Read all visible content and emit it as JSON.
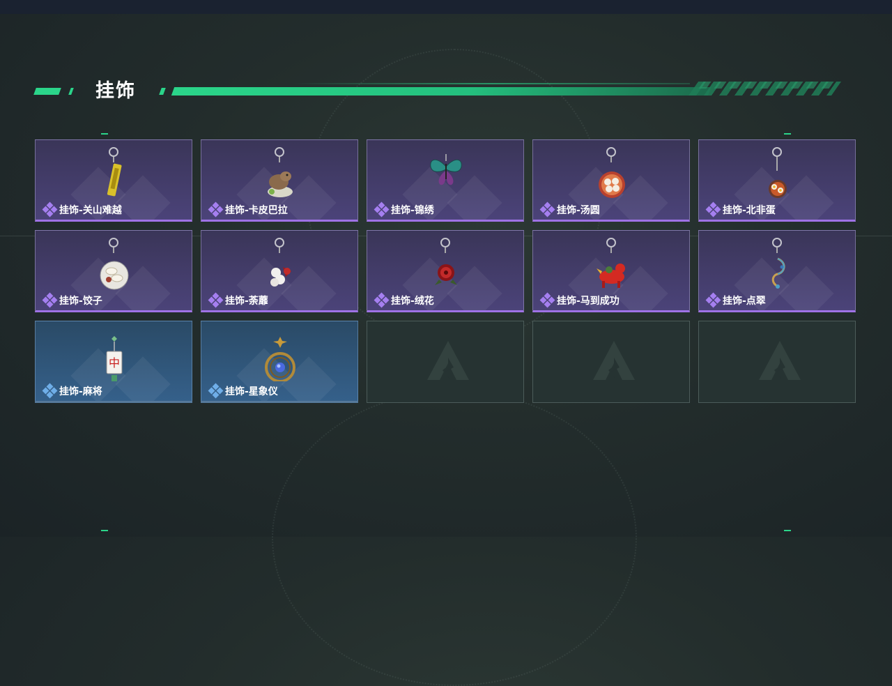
{
  "section": {
    "title": "挂饰"
  },
  "colors": {
    "accent": "#2bd58a",
    "purple_rarity": "#9f72e6",
    "blue_rarity": "#64a0de"
  },
  "items": [
    {
      "label": "挂饰-关山难越",
      "rarity": "purple",
      "icon": "yellow-talisman-icon"
    },
    {
      "label": "挂饰-卡皮巴拉",
      "rarity": "purple",
      "icon": "capybara-icon"
    },
    {
      "label": "挂饰-锦绣",
      "rarity": "purple",
      "icon": "butterfly-icon"
    },
    {
      "label": "挂饰-汤圆",
      "rarity": "purple",
      "icon": "tangyuan-bowl-icon"
    },
    {
      "label": "挂饰-北非蛋",
      "rarity": "purple",
      "icon": "shakshuka-icon"
    },
    {
      "label": "挂饰-饺子",
      "rarity": "purple",
      "icon": "dumpling-plate-icon"
    },
    {
      "label": "挂饰-荼蘼",
      "rarity": "purple",
      "icon": "flower-bunch-icon"
    },
    {
      "label": "挂饰-绒花",
      "rarity": "purple",
      "icon": "red-velvet-flower-icon"
    },
    {
      "label": "挂饰-马到成功",
      "rarity": "purple",
      "icon": "red-horse-icon"
    },
    {
      "label": "挂饰-点翠",
      "rarity": "purple",
      "icon": "kingfisher-ornament-icon"
    },
    {
      "label": "挂饰-麻将",
      "rarity": "blue",
      "icon": "mahjong-tile-icon"
    },
    {
      "label": "挂饰-星象仪",
      "rarity": "blue",
      "icon": "astrolabe-icon"
    }
  ],
  "empty_slots": 3
}
